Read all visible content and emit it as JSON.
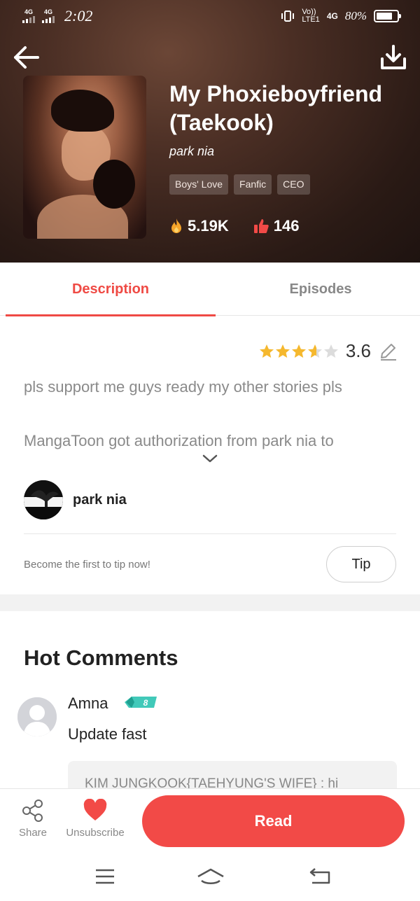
{
  "status_bar": {
    "sim1": "4G",
    "sim2": "4G",
    "time": "2:02",
    "volte": "Vo))",
    "lte": "LTE1",
    "net": "4G",
    "battery": "80%",
    "battery_level": 0.8
  },
  "header": {
    "back_icon": "arrow-left-icon",
    "download_icon": "download-icon"
  },
  "book": {
    "title": "My Phoxieboyfriend (Taekook)",
    "author": "park nia",
    "tags": [
      "Boys' Love",
      "Fanfic",
      "CEO"
    ],
    "views": "5.19K",
    "likes": "146"
  },
  "tabs": {
    "description": "Description",
    "episodes": "Episodes"
  },
  "description": {
    "rating": "3.6",
    "rating_stars": 3.6,
    "text": "pls support me guys ready my other stories pls",
    "authorization": "MangaToon got authorization from park nia to"
  },
  "author_row": {
    "name": "park nia"
  },
  "tip": {
    "text": "Become the first to tip now!",
    "button": "Tip"
  },
  "comments": {
    "title": "Hot Comments",
    "items": [
      {
        "name": "Amna",
        "level": "8",
        "text": "Update fast",
        "reply_preview": "KIM JUNGKOOK{TAEHYUNG'S WIFE} : hi"
      }
    ]
  },
  "bottom_bar": {
    "share": "Share",
    "unsubscribe": "Unsubscribe",
    "read": "Read"
  },
  "colors": {
    "accent": "#ef4a44",
    "read_button": "#f24a47",
    "star": "#f5b82e",
    "badge": "#39c6b8"
  }
}
